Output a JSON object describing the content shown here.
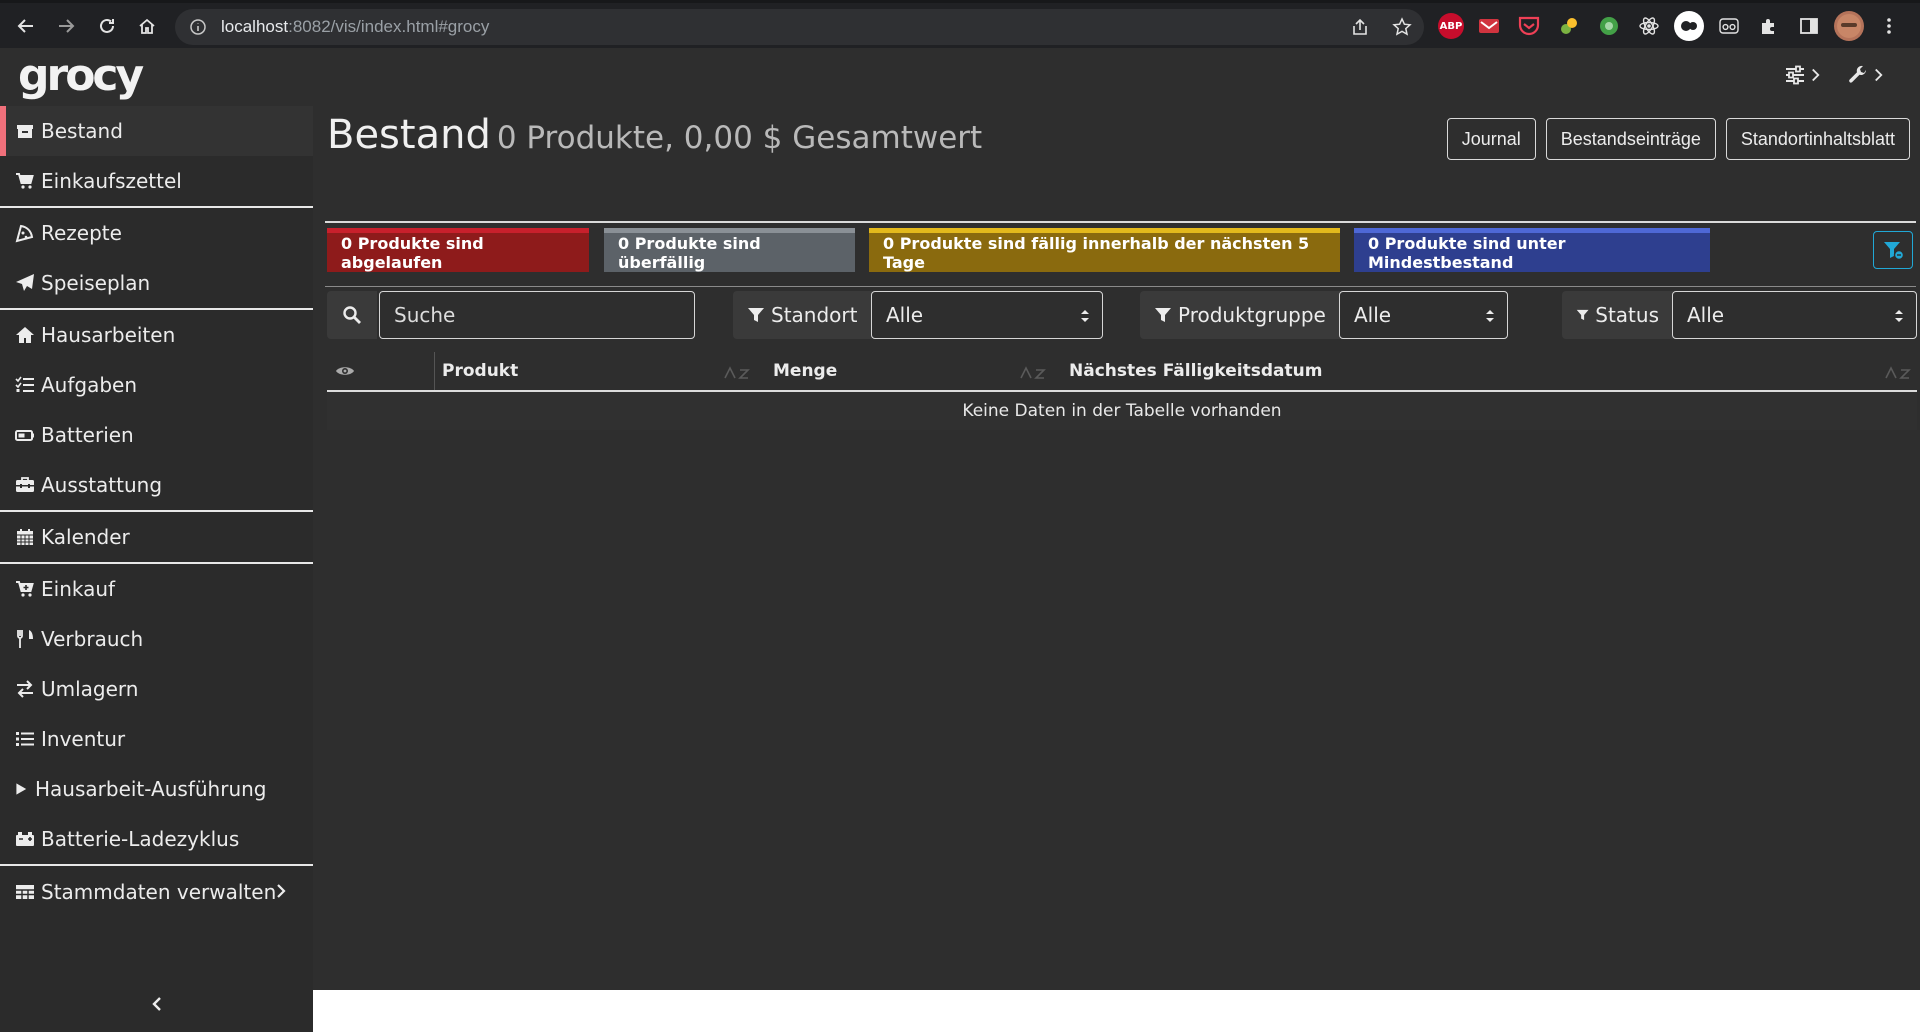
{
  "browser": {
    "url_host": "localhost",
    "url_rest": ":8082/vis/index.html#grocy",
    "extensions": [
      {
        "name": "abp",
        "label": "ABP",
        "color": "#c70d2c"
      },
      {
        "name": "mail",
        "label": "",
        "color": "#d0343f"
      },
      {
        "name": "pocket",
        "label": "",
        "color": "#ef4056"
      },
      {
        "name": "ext-green-1",
        "label": "",
        "color": "#7cb342"
      },
      {
        "name": "ext-green-2",
        "label": "",
        "color": "#43a047"
      },
      {
        "name": "react",
        "label": "",
        "color": "#202124"
      },
      {
        "name": "ext-circle",
        "label": "",
        "color": "#ffffff"
      },
      {
        "name": "ext-glasses",
        "label": "",
        "color": "#202124"
      }
    ]
  },
  "app": {
    "brand": "grocy"
  },
  "sidebar": {
    "groups": [
      [
        {
          "id": "bestand",
          "label": "Bestand",
          "icon": "box-icon",
          "active": true
        },
        {
          "id": "einkaufszettel",
          "label": "Einkaufszettel",
          "icon": "cart-icon"
        }
      ],
      [
        {
          "id": "rezepte",
          "label": "Rezepte",
          "icon": "pizza-icon"
        },
        {
          "id": "speiseplan",
          "label": "Speiseplan",
          "icon": "paper-plane-icon"
        }
      ],
      [
        {
          "id": "hausarbeiten",
          "label": "Hausarbeiten",
          "icon": "home-icon"
        },
        {
          "id": "aufgaben",
          "label": "Aufgaben",
          "icon": "tasks-icon"
        },
        {
          "id": "batterien",
          "label": "Batterien",
          "icon": "battery-icon"
        },
        {
          "id": "ausstattung",
          "label": "Ausstattung",
          "icon": "toolbox-icon"
        }
      ],
      [
        {
          "id": "kalender",
          "label": "Kalender",
          "icon": "calendar-icon"
        }
      ],
      [
        {
          "id": "einkauf",
          "label": "Einkauf",
          "icon": "cart-plus-icon"
        },
        {
          "id": "verbrauch",
          "label": "Verbrauch",
          "icon": "utensils-icon"
        },
        {
          "id": "umlagern",
          "label": "Umlagern",
          "icon": "exchange-icon"
        },
        {
          "id": "inventur",
          "label": "Inventur",
          "icon": "list-icon"
        },
        {
          "id": "hausarbeit-ausfuehrung",
          "label": "Hausarbeit-Ausführung",
          "icon": "play-icon"
        },
        {
          "id": "batterie-ladezyklus",
          "label": "Batterie-Ladezyklus",
          "icon": "car-battery-icon"
        }
      ],
      [
        {
          "id": "stammdaten",
          "label": "Stammdaten verwalten",
          "icon": "table-icon",
          "chevron": true
        }
      ]
    ]
  },
  "page": {
    "title": "Bestand",
    "subtitle": "0 Produkte, 0,00 $ Gesamtwert",
    "buttons": {
      "journal": "Journal",
      "entries": "Bestandseinträge",
      "location_sheet": "Standortinhaltsblatt"
    }
  },
  "status": {
    "expired": {
      "label": "0 Produkte sind abgelaufen",
      "color": "#8e1b1b",
      "border": "#c8202c"
    },
    "overdue": {
      "label": "0 Produkte sind überfällig",
      "color": "#5c6268",
      "border": "#8a9096"
    },
    "due_soon": {
      "label": "0 Produkte sind fällig innerhalb der nächsten 5 Tage",
      "color": "#8a6a0e",
      "border": "#e3b91c"
    },
    "below_min": {
      "label": "0 Produkte sind unter Mindestbestand",
      "color": "#2e3f8f",
      "border": "#4e68d6"
    }
  },
  "filters": {
    "search_placeholder": "Suche",
    "location_label": "Standort",
    "location_value": "Alle",
    "group_label": "Produktgruppe",
    "group_value": "Alle",
    "status_label": "Status",
    "status_value": "Alle"
  },
  "table": {
    "columns": {
      "product": "Produkt",
      "amount": "Menge",
      "next_due": "Nächstes Fälligkeitsdatum"
    },
    "empty": "Keine Daten in der Tabelle vorhanden"
  }
}
